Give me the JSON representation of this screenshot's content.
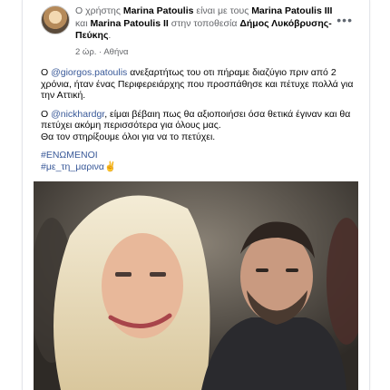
{
  "header": {
    "prefix": "Ο χρήστης ",
    "author": "Marina Patoulis",
    "middle": " είναι με τους ",
    "with1": "Marina Patoulis III",
    "conj": " και ",
    "with2": "Marina Patoulis II",
    "loc_text": " στην τοποθεσία ",
    "location": "Δήμος Λυκόβρυσης-Πεύκης",
    "end": ".",
    "time": "2 ώρ.",
    "place": "Αθήνα",
    "sep": "·",
    "more": "•••"
  },
  "post": {
    "p1_pre": "Ο ",
    "p1_mention": "@giorgos.patoulis",
    "p1_text": " ανεξαρτήτως του οτι πήραμε διαζύγιο πριν από 2 χρόνια, ήταν ένας Περιφερειάρχης που προσπάθησε και πέτυχε πολλά για την Αττική.",
    "p2_pre": "Ο ",
    "p2_mention": "@nickhardgr",
    "p2_text": ",  είμαι βέβαιη πως θα  αξιοποιήσει όσα θετικά έγιναν και θα πετύχει ακόμη περισσότερα για όλους μας.",
    "p2_line2": "Θα τον στηρίξουμε όλοι για να το πετύχει.",
    "hashtag1": "#ΕΝΩΜΕΝΟΙ",
    "hashtag2": "#με_τη_μαρινα✌️"
  },
  "colors": {
    "link": "#385898",
    "text": "#050505",
    "muted": "#65676b"
  }
}
